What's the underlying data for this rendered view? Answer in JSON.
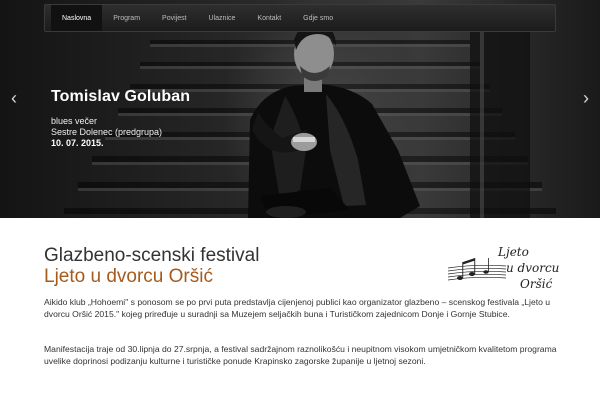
{
  "nav": {
    "items": [
      {
        "label": "Naslovna",
        "active": true
      },
      {
        "label": "Program",
        "active": false
      },
      {
        "label": "Povijest",
        "active": false
      },
      {
        "label": "Ulaznice",
        "active": false
      },
      {
        "label": "Kontakt",
        "active": false
      },
      {
        "label": "Gdje smo",
        "active": false
      }
    ]
  },
  "slider": {
    "prev_icon": "chevron-left",
    "next_icon": "chevron-right",
    "caption": {
      "title": "Tomislav Goluban",
      "line1": "blues večer",
      "line2": "Sestre Dolenec (predgrupa)",
      "date": "10. 07. 2015."
    }
  },
  "main": {
    "heading": "Glazbeno-scenski festival",
    "subheading": "Ljeto u dvorcu Oršić",
    "logo_text": [
      "Ljeto",
      "u dvorcu",
      "Oršić"
    ],
    "paragraph1": "Aikido klub „Hohoemi\" s ponosom se po prvi puta predstavlja cijenjenoj publici kao organizator glazbeno – scenskog festivala „Ljeto u dvorcu Oršić 2015.\" kojeg priređuje u suradnji sa Muzejem seljačkih buna i Turističkom zajednicom Donje i Gornje Stubice.",
    "paragraph2": "Manifestacija traje od 30.lipnja do 27.srpnja, a festival sadržajnom raznolikošću i neupitnom visokom umjetničkom kvalitetom programa uvelike doprinosi podizanju kulturne i turističke ponude Krapinsko zagorske županije u ljetnoj sezoni."
  },
  "colors": {
    "accent": "#a55a1e",
    "nav_bg": "#222222",
    "hero_bg": "#1b1b1b"
  }
}
